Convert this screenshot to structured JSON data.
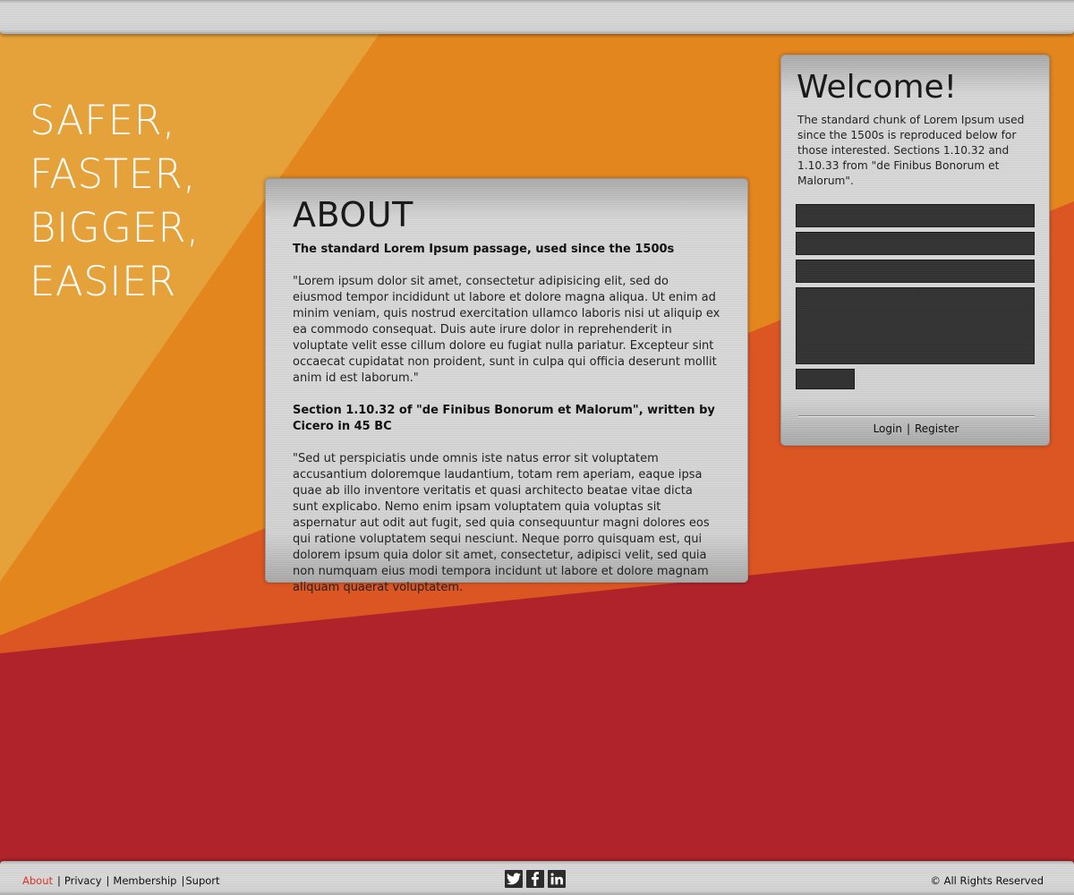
{
  "colors": {
    "light_orange": "#E6A23A",
    "orange": "#E3861E",
    "dark_orange": "#DC5623",
    "red": "#B0232A",
    "active_link": "#D9342B"
  },
  "hero": {
    "lines": [
      "SAFER,",
      "FASTER,",
      "BIGGER,",
      "EASIER"
    ]
  },
  "about": {
    "title": "ABOUT",
    "subtitle1": "The standard Lorem Ipsum passage, used since the 1500s",
    "paragraph1": "\"Lorem ipsum dolor sit amet, consectetur adipisicing elit, sed do eiusmod tempor incididunt ut labore et dolore magna aliqua. Ut enim ad minim veniam, quis nostrud exercitation ullamco laboris nisi ut aliquip ex ea commodo consequat. Duis aute irure dolor in reprehenderit in voluptate velit esse cillum dolore eu fugiat nulla pariatur. Excepteur sint occaecat cupidatat non proident, sunt in culpa qui officia deserunt mollit anim id est laborum.\"",
    "subtitle2": "Section 1.10.32 of \"de Finibus Bonorum et Malorum\", written by Cicero in 45 BC",
    "paragraph2": "\"Sed ut perspiciatis unde omnis iste natus error sit voluptatem accusantium doloremque laudantium, totam rem aperiam, eaque ipsa quae ab illo inventore veritatis et quasi architecto beatae vitae dicta sunt explicabo. Nemo enim ipsam voluptatem quia voluptas sit aspernatur aut odit aut fugit, sed quia consequuntur magni dolores eos qui ratione voluptatem sequi nesciunt. Neque porro quisquam est, qui dolorem ipsum quia dolor sit amet, consectetur, adipisci velit, sed quia non numquam eius modi tempora incidunt ut labore et dolore magnam aliquam quaerat voluptatem."
  },
  "welcome": {
    "title": "Welcome!",
    "text": "The standard chunk of Lorem Ipsum used since the 1500s is reproduced below for those interested. Sections 1.10.32 and 1.10.33 from \"de Finibus Bonorum et Malorum\".",
    "links": [
      "Login",
      "Register"
    ]
  },
  "footer": {
    "links": [
      "About",
      "Privacy",
      "Membership",
      "Suport"
    ],
    "active_link": "About",
    "social": [
      "twitter-icon",
      "facebook-icon",
      "linkedin-icon"
    ],
    "copyright": "©  All Rights Reserved"
  }
}
